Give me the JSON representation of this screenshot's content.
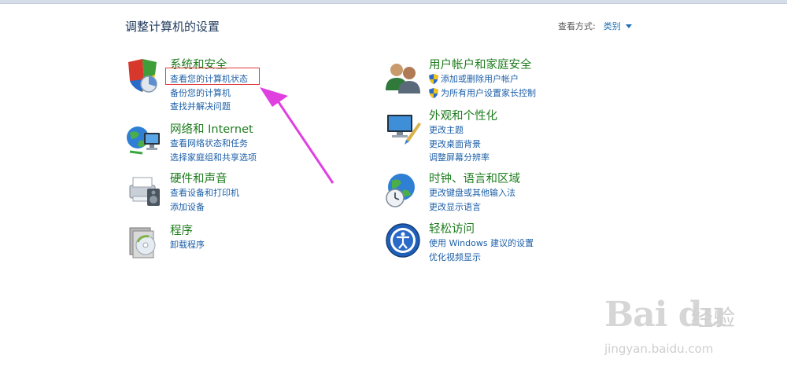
{
  "page": {
    "title": "调整计算机的设置"
  },
  "view_by": {
    "label": "查看方式:",
    "value": "类别"
  },
  "categories_left": [
    {
      "heading": "系统和安全",
      "icon": "system-security-icon",
      "links": [
        "查看您的计算机状态",
        "备份您的计算机",
        "查找并解决问题"
      ]
    },
    {
      "heading": "网络和 Internet",
      "icon": "network-internet-icon",
      "links": [
        "查看网络状态和任务",
        "选择家庭组和共享选项"
      ]
    },
    {
      "heading": "硬件和声音",
      "icon": "hardware-sound-icon",
      "links": [
        "查看设备和打印机",
        "添加设备"
      ]
    },
    {
      "heading": "程序",
      "icon": "programs-icon",
      "links": [
        "卸载程序"
      ]
    }
  ],
  "categories_right": [
    {
      "heading": "用户帐户和家庭安全",
      "icon": "user-accounts-icon",
      "links": [
        "添加或删除用户帐户",
        "为所有用户设置家长控制"
      ]
    },
    {
      "heading": "外观和个性化",
      "icon": "appearance-icon",
      "links": [
        "更改主题",
        "更改桌面背景",
        "调整屏幕分辨率"
      ]
    },
    {
      "heading": "时钟、语言和区域",
      "icon": "clock-language-region-icon",
      "links": [
        "更改键盘或其他输入法",
        "更改显示语言"
      ]
    },
    {
      "heading": "轻松访问",
      "icon": "ease-of-access-icon",
      "links": [
        "使用 Windows 建议的设置",
        "优化视频显示"
      ]
    }
  ],
  "annotation": {
    "highlight_color": "#e23838",
    "arrow_color": "#e040e0"
  },
  "watermark": {
    "logo": "Bai du",
    "cn": "经验",
    "url": "jingyan.baidu.com"
  },
  "colors": {
    "heading": "#1e7d1e",
    "link": "#1c5fa8",
    "title": "#1e395b"
  }
}
